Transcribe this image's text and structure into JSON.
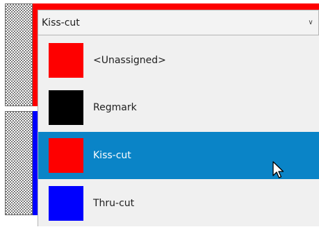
{
  "combo": {
    "value": "Kiss-cut",
    "chevron_icon": "chevron-down-icon"
  },
  "options": [
    {
      "label": "<Unassigned>",
      "color": "#fe0000",
      "selected": false
    },
    {
      "label": "Regmark",
      "color": "#000000",
      "selected": false
    },
    {
      "label": "Kiss-cut",
      "color": "#fe0000",
      "selected": true
    },
    {
      "label": "Thru-cut",
      "color": "#0000fe",
      "selected": false
    }
  ],
  "colors": {
    "highlight": "#0a84c7",
    "red": "#fe0000",
    "blue": "#0000fe",
    "black": "#000000"
  },
  "cursor_icon": "mouse-pointer-icon"
}
